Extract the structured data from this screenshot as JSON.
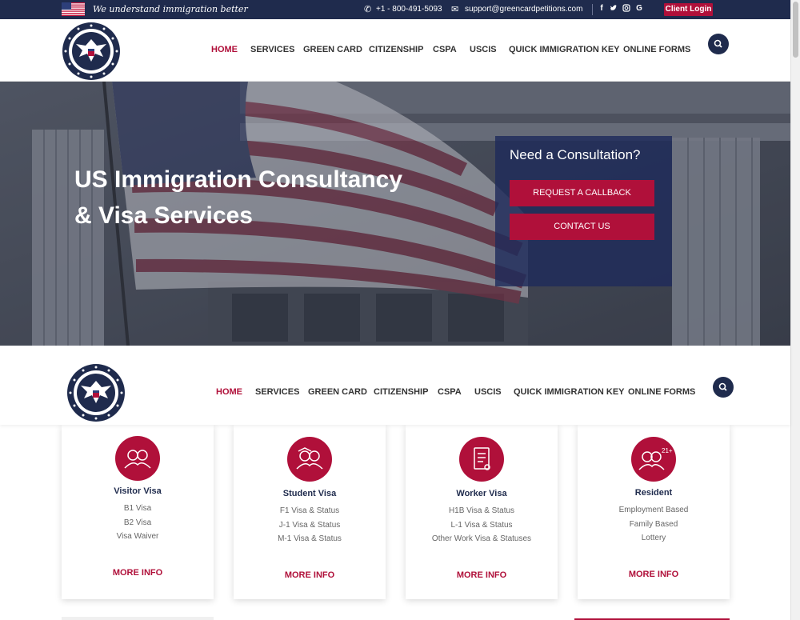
{
  "topbar": {
    "tagline": "We understand immigration better",
    "phone": "+1 - 800-491-5093",
    "email": "support@greencardpetitions.com",
    "social": [
      "f",
      "t",
      "ig",
      "G"
    ],
    "client_login": "Client Login"
  },
  "nav": {
    "items": [
      "HOME",
      "SERVICES",
      "GREEN CARD",
      "CITIZENSHIP",
      "CSPA",
      "USCIS",
      "QUICK IMMIGRATION KEY",
      "ONLINE FORMS"
    ],
    "active": "HOME"
  },
  "hero": {
    "title_line1": "US Immigration Consultancy",
    "title_line2": "& Visa Services",
    "consult_title": "Need a Consultation?",
    "callback_label": "REQUEST A CALLBACK",
    "contact_label": "CONTACT US"
  },
  "cards": [
    {
      "title": "Visitor Visa",
      "lines": [
        "B1 Visa",
        "B2 Visa",
        "Visa Waiver"
      ],
      "more": "MORE INFO",
      "icon": "people-icon"
    },
    {
      "title": "Student Visa",
      "lines": [
        "F1 Visa & Status",
        "J-1 Visa & Status",
        "M-1 Visa & Status"
      ],
      "more": "MORE INFO",
      "icon": "students-icon"
    },
    {
      "title": "Worker Visa",
      "lines": [
        "H1B Visa & Status",
        "L-1 Visa & Status",
        "Other Work Visa & Statuses"
      ],
      "more": "MORE INFO",
      "icon": "document-icon"
    },
    {
      "title": "Resident",
      "lines": [
        "Employment Based",
        "Family Based",
        "Lottery"
      ],
      "more": "MORE INFO",
      "icon": "residents-21-icon"
    }
  ],
  "colors": {
    "navy": "#1f2b4d",
    "accent": "#b0103a"
  }
}
